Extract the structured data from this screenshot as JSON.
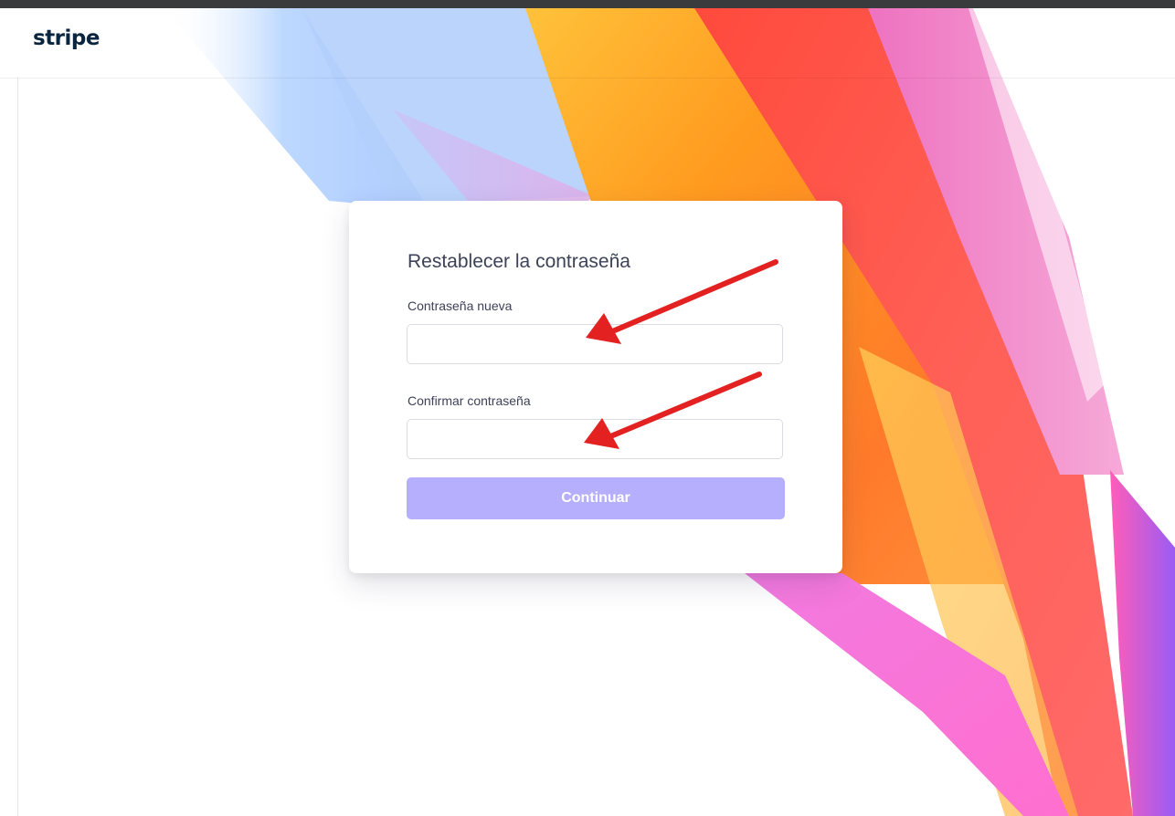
{
  "brand": {
    "logo_text": "stripe"
  },
  "card": {
    "title": "Restablecer la contraseña",
    "new_password": {
      "label": "Contraseña nueva",
      "value": "",
      "placeholder": ""
    },
    "confirm_password": {
      "label": "Confirmar contraseña",
      "value": "",
      "placeholder": ""
    },
    "submit_label": "Continuar"
  },
  "colors": {
    "brand_text": "#0a2540",
    "button_disabled": "#b5affe",
    "annotation_arrow": "#e32121"
  }
}
